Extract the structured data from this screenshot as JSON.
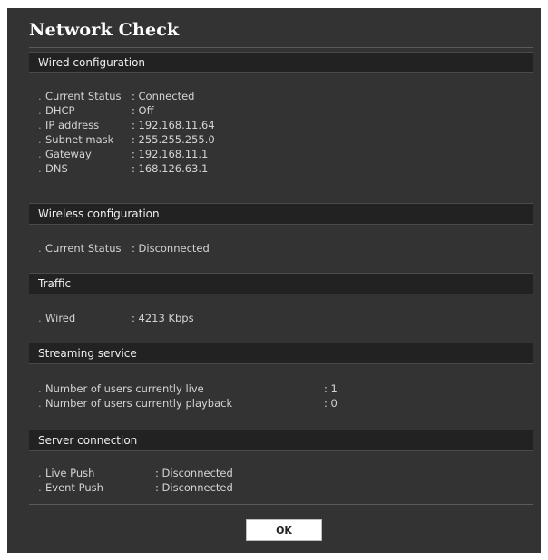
{
  "dialog": {
    "title": "Network Check",
    "ok_label": "OK"
  },
  "wired": {
    "header": "Wired configuration",
    "items": [
      {
        "label": "Current Status",
        "value": ": Connected"
      },
      {
        "label": "DHCP",
        "value": ": Off"
      },
      {
        "label": "IP address",
        "value": ": 192.168.11.64"
      },
      {
        "label": "Subnet mask",
        "value": ": 255.255.255.0"
      },
      {
        "label": "Gateway",
        "value": ": 192.168.11.1"
      },
      {
        "label": "DNS",
        "value": ": 168.126.63.1"
      }
    ]
  },
  "wireless": {
    "header": "Wireless configuration",
    "items": [
      {
        "label": "Current Status",
        "value": ": Disconnected"
      }
    ]
  },
  "traffic": {
    "header": "Traffic",
    "items": [
      {
        "label": "Wired",
        "value": ": 4213 Kbps"
      }
    ]
  },
  "streaming": {
    "header": "Streaming service",
    "items": [
      {
        "label": "Number of users currently live",
        "value": ": 1"
      },
      {
        "label": "Number of users currently playback",
        "value": ": 0"
      }
    ]
  },
  "server": {
    "header": "Server connection",
    "items": [
      {
        "label": "Live Push",
        "value": ": Disconnected"
      },
      {
        "label": "Event Push",
        "value": ": Disconnected"
      }
    ]
  }
}
